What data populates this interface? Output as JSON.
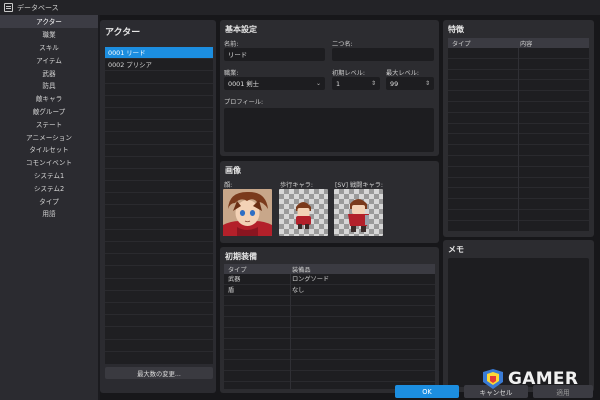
{
  "window": {
    "title": "データベース"
  },
  "sidebar": {
    "items": [
      {
        "label": "アクター",
        "active": true
      },
      {
        "label": "職業"
      },
      {
        "label": "スキル"
      },
      {
        "label": "アイテム"
      },
      {
        "label": "武器"
      },
      {
        "label": "防具"
      },
      {
        "label": "敵キャラ"
      },
      {
        "label": "敵グループ"
      },
      {
        "label": "ステート"
      },
      {
        "label": "アニメーション"
      },
      {
        "label": "タイルセット"
      },
      {
        "label": "コモンイベント"
      },
      {
        "label": "システム1"
      },
      {
        "label": "システム2"
      },
      {
        "label": "タイプ"
      },
      {
        "label": "用語"
      }
    ]
  },
  "actors": {
    "title": "アクター",
    "items": [
      "0001 リード",
      "0002 プリシア"
    ],
    "max_button": "最大数の変更..."
  },
  "basic": {
    "title": "基本設定",
    "name_label": "名前:",
    "name_value": "リード",
    "nickname_label": "二つ名:",
    "nickname_value": "",
    "class_label": "職業:",
    "class_value": "0001 剣士",
    "initial_level_label": "初期レベル:",
    "initial_level_value": "1",
    "max_level_label": "最大レベル:",
    "max_level_value": "99",
    "profile_label": "プロフィール:"
  },
  "images": {
    "title": "画像",
    "face_label": "顔:",
    "character_label": "歩行キャラ:",
    "battler_label": "[SV] 戦闘キャラ:"
  },
  "equipment": {
    "title": "初期装備",
    "headers": [
      "タイプ",
      "装備品"
    ],
    "rows": [
      {
        "type": "武器",
        "item": "ロングソード"
      },
      {
        "type": "盾",
        "item": "なし"
      }
    ]
  },
  "traits": {
    "title": "特徴",
    "headers": [
      "タイプ",
      "内容"
    ]
  },
  "memo": {
    "title": "メモ"
  },
  "buttons": {
    "ok": "OK",
    "cancel": "キャンセル",
    "apply": "適用"
  },
  "watermark": {
    "text": "GAMER"
  },
  "colors": {
    "accent": "#1c8ee0",
    "panel": "#2c2c30",
    "background": "#17171a"
  }
}
